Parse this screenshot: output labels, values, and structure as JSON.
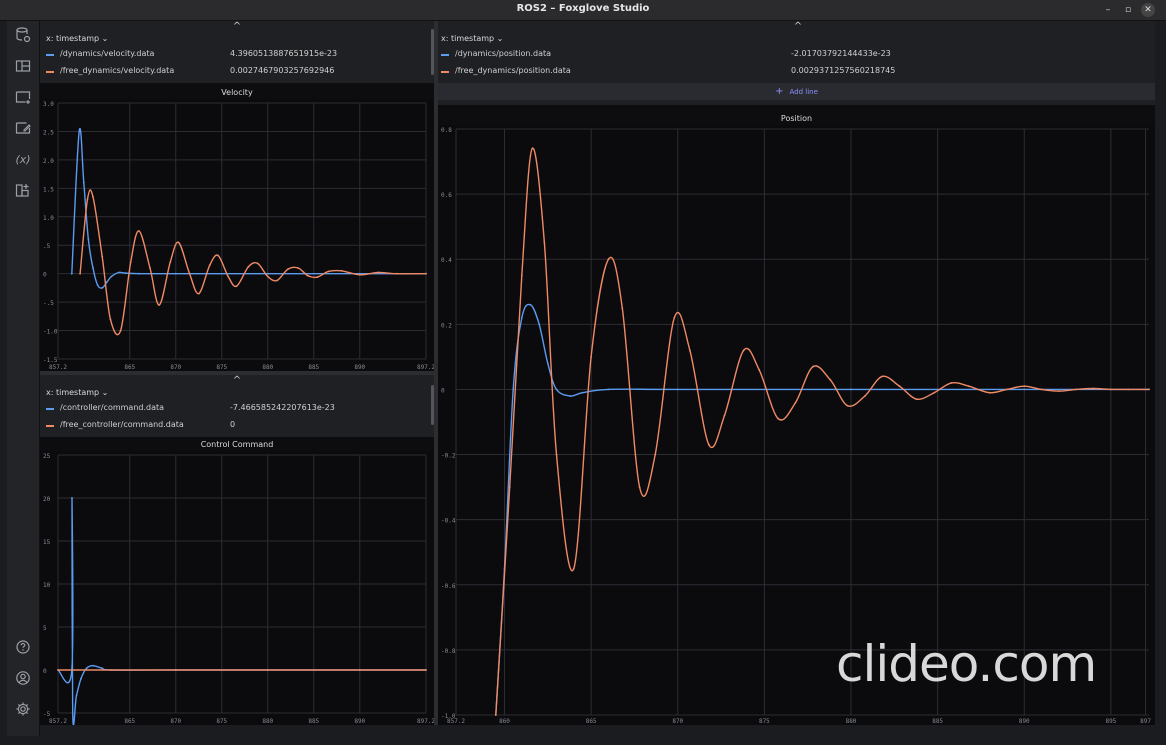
{
  "window": {
    "title": "ROS2 – Foxglove Studio",
    "btn_min": "–",
    "btn_max": "▫",
    "btn_close": "✕"
  },
  "sidebar": {
    "top_icons": [
      "connection-icon",
      "layout-icon",
      "add-panel-icon",
      "panel-settings-icon",
      "variables-icon",
      "extensions-icon"
    ],
    "bottom_icons": [
      "help-icon",
      "account-icon",
      "settings-icon"
    ],
    "variables_glyph": "(x)"
  },
  "velocity": {
    "xaxis": "x: timestamp",
    "caret": "^",
    "series": [
      {
        "topic": "/dynamics/velocity.data",
        "value": "4.3960513887651915e-23",
        "color": "#5b9bf0"
      },
      {
        "topic": "/free_dynamics/velocity.data",
        "value": "0.0027467903257692946",
        "color": "#f08a65"
      }
    ],
    "title": "Velocity",
    "chart_data": {
      "type": "line",
      "title": "Velocity",
      "xlim": [
        857.2,
        897.2
      ],
      "ylim": [
        -1.5,
        3.0
      ],
      "x_ticks": [
        "857.2",
        "865",
        "870",
        "875",
        "880",
        "885",
        "890",
        "897.2"
      ],
      "y_ticks": [
        "3.0",
        "2.5",
        "2.0",
        "1.5",
        "1.0",
        ".5",
        "0",
        "-.5",
        "-1.0",
        "-1.5"
      ],
      "series": [
        {
          "name": "/dynamics/velocity.data",
          "color": "#5b9bf0",
          "x": [
            858.7,
            859.5,
            860.0,
            860.5,
            861.0,
            861.5,
            862.0,
            862.5,
            863.0,
            863.8,
            864.5,
            866,
            870,
            880,
            890,
            897.2
          ],
          "y": [
            0,
            2.5,
            1.6,
            0.6,
            0.1,
            -0.2,
            -0.25,
            -0.15,
            -0.05,
            0.02,
            0.01,
            0.0,
            0.0,
            0.0,
            0.0,
            0.0
          ]
        },
        {
          "name": "/free_dynamics/velocity.data",
          "color": "#f08a65",
          "x": [
            859.6,
            860.4,
            861.0,
            862.0,
            862.9,
            864.0,
            865.1,
            866.0,
            867.2,
            868.2,
            869.4,
            870.3,
            871.5,
            872.5,
            873.7,
            874.6,
            875.7,
            876.6,
            877.9,
            878.9,
            880.0,
            881.0,
            882.2,
            883.3,
            884.4,
            885.4,
            886.6,
            888.0,
            890.0,
            892.0,
            894.0,
            897.2
          ],
          "y": [
            0,
            1.3,
            1.35,
            0.3,
            -0.8,
            -1.0,
            0.2,
            0.75,
            0.1,
            -0.55,
            0.2,
            0.55,
            0.0,
            -0.35,
            0.15,
            0.32,
            -0.05,
            -0.22,
            0.12,
            0.18,
            -0.05,
            -0.12,
            0.08,
            0.1,
            -0.04,
            -0.06,
            0.04,
            0.05,
            -0.02,
            0.02,
            0.0,
            0.0
          ]
        }
      ]
    }
  },
  "command": {
    "xaxis": "x: timestamp",
    "caret": "^",
    "series": [
      {
        "topic": "/controller/command.data",
        "value": "-7.466585242207613e-23",
        "color": "#5b9bf0"
      },
      {
        "topic": "/free_controller/command.data",
        "value": "0",
        "color": "#f08a65"
      }
    ],
    "title": "Control Command",
    "chart_data": {
      "type": "line",
      "title": "Control Command",
      "xlim": [
        857.2,
        897.2
      ],
      "ylim": [
        -5,
        25
      ],
      "x_ticks": [
        "857.2",
        "865",
        "870",
        "875",
        "880",
        "885",
        "890",
        "897.2"
      ],
      "y_ticks": [
        "25",
        "20",
        "15",
        "10",
        "5",
        "0",
        "-5"
      ],
      "series": [
        {
          "name": "/controller/command.data",
          "color": "#5b9bf0",
          "x": [
            857.2,
            858.7,
            858.72,
            858.8,
            859.2,
            859.7,
            860.3,
            861.0,
            862.0,
            863.0,
            870,
            880,
            890,
            897.2
          ],
          "y": [
            0,
            0,
            20,
            -5,
            -3,
            -1,
            0.2,
            0.5,
            0.2,
            0.0,
            0.0,
            0.0,
            0.0,
            0.0
          ]
        },
        {
          "name": "/free_controller/command.data",
          "color": "#f08a65",
          "x": [
            857.2,
            897.2
          ],
          "y": [
            0,
            0
          ]
        }
      ]
    }
  },
  "position": {
    "xaxis": "x: timestamp",
    "caret": "^",
    "series": [
      {
        "topic": "/dynamics/position.data",
        "value": "-2.01703792144433e-23",
        "color": "#5b9bf0"
      },
      {
        "topic": "/free_dynamics/position.data",
        "value": "0.0029371257560218745",
        "color": "#f08a65"
      }
    ],
    "add_line_label": "Add line",
    "add_line_icon": "+",
    "title": "Position",
    "chart_data": {
      "type": "line",
      "title": "Position",
      "xlim": [
        857.2,
        897.2
      ],
      "ylim": [
        -1.0,
        0.8
      ],
      "x_ticks": [
        "857.2",
        "860",
        "865",
        "870",
        "875",
        "880",
        "885",
        "890",
        "895",
        "897"
      ],
      "y_ticks": [
        "0.8",
        "0.6",
        "0.4",
        "0.2",
        "0",
        "-0.2",
        "-0.4",
        "-0.6",
        "-0.8",
        "-1.0"
      ],
      "series": [
        {
          "name": "/dynamics/position.data",
          "color": "#5b9bf0",
          "x": [
            859.5,
            860.0,
            860.5,
            861.0,
            861.5,
            862.0,
            862.5,
            863.0,
            863.8,
            864.5,
            866,
            870,
            880,
            890,
            897.2
          ],
          "y": [
            -1.0,
            -0.55,
            0.0,
            0.22,
            0.26,
            0.2,
            0.08,
            0.0,
            -0.02,
            -0.01,
            0.0,
            0.0,
            0.0,
            0.0,
            0.0
          ]
        },
        {
          "name": "/free_dynamics/position.data",
          "color": "#f08a65",
          "x": [
            859.5,
            860.3,
            861.0,
            861.6,
            862.3,
            863.0,
            864.0,
            865.0,
            866.0,
            866.8,
            867.8,
            868.7,
            869.8,
            870.7,
            871.8,
            872.7,
            873.8,
            874.7,
            875.8,
            876.8,
            877.8,
            878.8,
            879.8,
            880.8,
            881.8,
            882.8,
            883.8,
            884.8,
            885.8,
            886.8,
            888.0,
            889.0,
            890.0,
            891.0,
            892.0,
            893.0,
            894.0,
            895.0,
            896.0,
            897.2
          ],
          "y": [
            -1.0,
            -0.3,
            0.35,
            0.74,
            0.45,
            -0.2,
            -0.55,
            0.1,
            0.4,
            0.25,
            -0.3,
            -0.2,
            0.22,
            0.12,
            -0.17,
            -0.08,
            0.12,
            0.06,
            -0.09,
            -0.04,
            0.07,
            0.03,
            -0.05,
            -0.02,
            0.04,
            0.01,
            -0.03,
            -0.01,
            0.02,
            0.01,
            -0.01,
            0.0,
            0.01,
            0.0,
            -0.005,
            0.0,
            0.003,
            0.0,
            0.0,
            0.0
          ]
        }
      ]
    }
  },
  "watermark": "clideo.com"
}
